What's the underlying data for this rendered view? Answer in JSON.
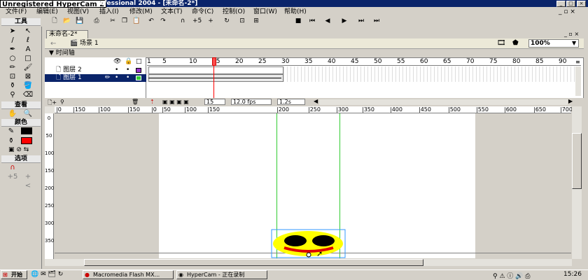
{
  "title": {
    "watermark": "Unregistered HyperCam 2",
    "text": "rofessional 2004 - [未命名-2*]"
  },
  "menu": [
    "文件(F)",
    "编辑(E)",
    "视图(V)",
    "插入(I)",
    "修改(M)",
    "文本(T)",
    "命令(C)",
    "控制(O)",
    "窗口(W)",
    "帮助(H)"
  ],
  "tools": {
    "header": "工具",
    "view_header": "查看",
    "color_header": "颜色",
    "options_header": "选项",
    "stroke_color": "#000000",
    "fill_color": "#ff0000"
  },
  "document": {
    "tab": "未命名-2*",
    "scene": "场景 1",
    "zoom": "100%"
  },
  "timeline": {
    "header": "时间轴",
    "layers": [
      {
        "name": "图层 2",
        "selected": false,
        "color": "#9933cc"
      },
      {
        "name": "图层 1",
        "selected": true,
        "color": "#33cc33"
      }
    ],
    "frame_numbers": [
      "1",
      "5",
      "10",
      "15",
      "20",
      "25",
      "30",
      "35",
      "40",
      "45",
      "50",
      "55",
      "60",
      "65",
      "70",
      "75",
      "80",
      "85",
      "90"
    ],
    "current_frame": "15",
    "fps": "12.0 fps",
    "time": "1.2s"
  },
  "ruler": {
    "h_labels": [
      "0",
      "150",
      "100",
      "150",
      "0",
      "50",
      "100",
      "150",
      "200",
      "250",
      "300",
      "350",
      "400",
      "450",
      "500",
      "550",
      "600",
      "650",
      "700"
    ],
    "v_labels": [
      "0",
      "50",
      "100",
      "150",
      "200",
      "250",
      "300",
      "350"
    ]
  },
  "colors": {
    "face": "#ffff00",
    "eyes": "#000000",
    "mouth": "#dd0000",
    "guide": "#33cc33",
    "selection": "#3399ff"
  },
  "taskbar": {
    "start": "开始",
    "items": [
      "Macromedia Flash MX...",
      "HyperCam - 正在录制"
    ],
    "clock": "15:26"
  }
}
